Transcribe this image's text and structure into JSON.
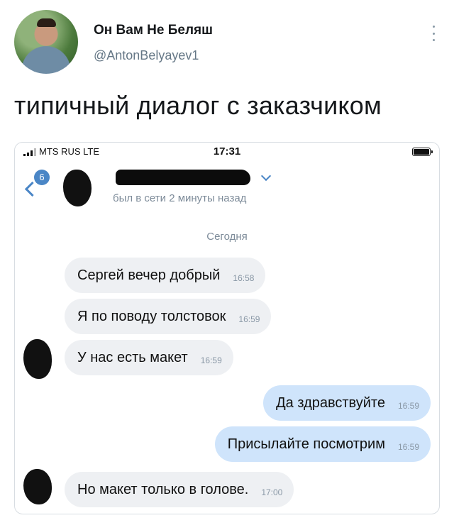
{
  "tweet": {
    "author_name": "Он Вам Не Беляш",
    "author_handle": "@AntonBelyayev1",
    "text": "типичный диалог с заказчиком"
  },
  "phone": {
    "status_bar": {
      "carrier": "MTS RUS  LTE",
      "time": "17:31"
    },
    "chat_header": {
      "unread_count": "6",
      "last_seen": "был в сети 2 минуты назад"
    },
    "date_separator": "Сегодня",
    "messages": [
      {
        "direction": "in",
        "text": "Сергей вечер добрый",
        "time": "16:58"
      },
      {
        "direction": "in",
        "text": "Я по поводу толстовок",
        "time": "16:59"
      },
      {
        "direction": "in",
        "text": "У нас есть макет",
        "time": "16:59"
      },
      {
        "direction": "out",
        "text": "Да здравствуйте",
        "time": "16:59"
      },
      {
        "direction": "out",
        "text": "Присылайте посмотрим",
        "time": "16:59"
      },
      {
        "direction": "in",
        "text": "Но макет только в голове.",
        "time": "17:00"
      }
    ]
  },
  "colors": {
    "accent": "#4a86c6",
    "incoming_bubble": "#eef0f3",
    "outgoing_bubble": "#cfe4fb"
  },
  "icons": [
    "more-icon",
    "signal-icon",
    "battery-icon",
    "back-icon",
    "chevron-down-icon"
  ]
}
